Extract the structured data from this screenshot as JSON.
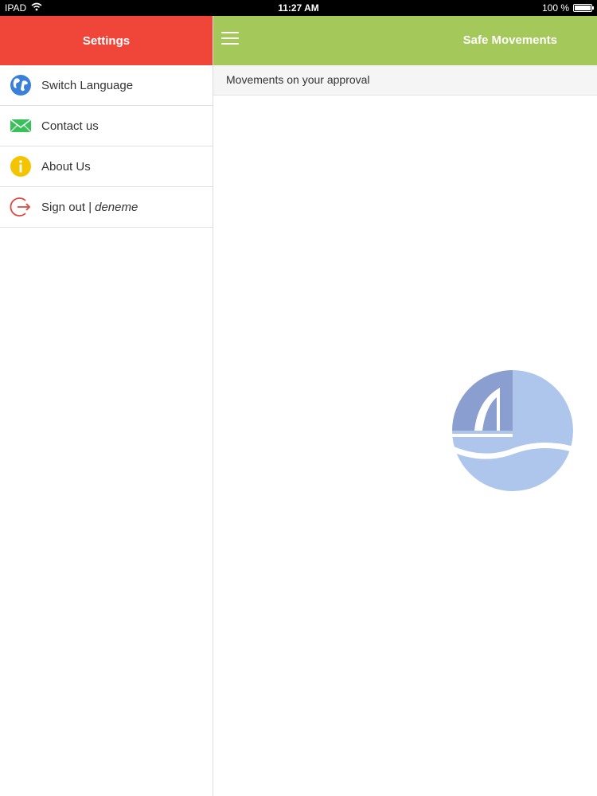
{
  "status_bar": {
    "device": "IPAD",
    "time": "11:27 AM",
    "battery": "100 %",
    "battery_level": 1.0
  },
  "sidebar": {
    "title": "Settings",
    "items": [
      {
        "label": "Switch Language",
        "icon": "globe-icon"
      },
      {
        "label": "Contact us",
        "icon": "mail-icon"
      },
      {
        "label": "About Us",
        "icon": "info-icon"
      },
      {
        "label": "Sign out |",
        "user": "deneme",
        "icon": "signout-icon"
      }
    ]
  },
  "main": {
    "title": "Safe Movements",
    "menu_icon": "hamburger-menu-icon",
    "subheader": "Movements on your approval",
    "logo": "app-logo"
  },
  "colors": {
    "sidebar_header": "#f0463a",
    "topbar": "#a4c95a",
    "globe": "#3a7fd9",
    "mail": "#38c05a",
    "info": "#f5c400",
    "signout": "#e0463a",
    "logo_dark": "#8a9fcf",
    "logo_light": "#aec6ec"
  }
}
